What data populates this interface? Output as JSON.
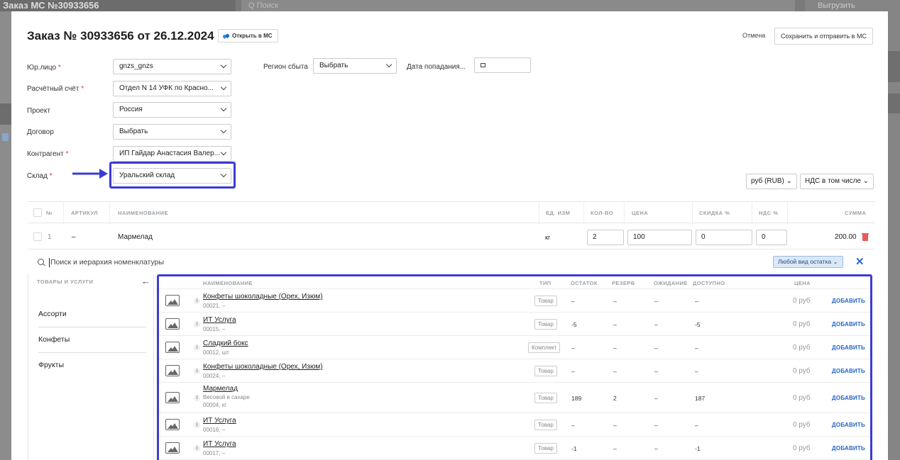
{
  "background": {
    "top_title": "Заказ МС №30933656",
    "search_placeholder": "Q Поиск",
    "action_button": "Выгрузить"
  },
  "header": {
    "title": "Заказ № 30933656 от 26.12.2024",
    "open_ms_label": "Открыть в МС",
    "cancel_label": "Отмена",
    "save_label": "Сохранить и отправить в МС"
  },
  "form": {
    "legal_entity": {
      "label": "Юр.лицо",
      "value": "gnzs_gnzs"
    },
    "account": {
      "label": "Расчётный счёт",
      "value": "Отдел N 14 УФК по Красно..."
    },
    "project": {
      "label": "Проект",
      "value": "Россия"
    },
    "contract": {
      "label": "Договор",
      "value": "Выбрать"
    },
    "counterparty": {
      "label": "Контрагент",
      "value": "ИП Гайдар Анастасия Валер..."
    },
    "warehouse": {
      "label": "Склад",
      "value": "Уральский склад"
    },
    "region": {
      "label": "Регион сбыта",
      "value": "Выбрать"
    },
    "date": {
      "label": "Дата попадания..."
    },
    "required_mark": "*",
    "currency": "руб (RUB)",
    "vat_mode": "НДС в том числе"
  },
  "order_table": {
    "columns": [
      "№",
      "АРТИКУЛ",
      "НАИМЕНОВАНИЕ",
      "ЕД. ИЗМ",
      "КОЛ-ВО",
      "ЦЕНА",
      "СКИДКА %",
      "НДС %",
      "СУММА"
    ],
    "rows": [
      {
        "num": "1",
        "article": "–",
        "name": "Мармелад",
        "unit": "кг",
        "qty": "2",
        "price": "100",
        "discount": "0",
        "vat": "0",
        "sum": "200.00"
      }
    ]
  },
  "search": {
    "placeholder": "Поиск и иерархия номенклатуры",
    "stock_filter": "Любой вид остатка",
    "close": "✕"
  },
  "categories": {
    "header": "ТОВАРЫ И УСЛУГИ",
    "back": "←",
    "items": [
      "Ассорти",
      "Конфеты",
      "Фрукты"
    ]
  },
  "products": {
    "columns": {
      "name": "НАИМЕНОВАНИЕ",
      "type": "ТИП",
      "stock": "ОСТАТОК",
      "reserve": "РЕЗЕРВ",
      "waiting": "ОЖИДАНИЕ",
      "available": "ДОСТУПНО",
      "price": "ЦЕНА"
    },
    "add_label": "ДОБАВИТЬ",
    "info": "i",
    "rows": [
      {
        "name": "Конфеты шоколадные (Орех, Изюм)",
        "desc": "",
        "code": "00021, –",
        "type": "Товар",
        "stock": "–",
        "reserve": "–",
        "waiting": "–",
        "available": "–",
        "price": "0 руб"
      },
      {
        "name": "ИТ Услуга",
        "desc": "",
        "code": "00015, –",
        "type": "Товар",
        "stock": "-5",
        "reserve": "–",
        "waiting": "–",
        "available": "-5",
        "price": "0 руб"
      },
      {
        "name": "Сладкий бокс",
        "desc": "",
        "code": "00012, шт",
        "type": "Комплект",
        "stock": "–",
        "reserve": "–",
        "waiting": "–",
        "available": "–",
        "price": "0 руб"
      },
      {
        "name": "Конфеты шоколадные (Орех, Изюм)",
        "desc": "",
        "code": "00024, –",
        "type": "Товар",
        "stock": "–",
        "reserve": "–",
        "waiting": "–",
        "available": "–",
        "price": "0 руб"
      },
      {
        "name": "Мармелад",
        "desc": "Весовой в сахаре",
        "code": "00004, кг",
        "type": "Товар",
        "stock": "189",
        "reserve": "2",
        "waiting": "–",
        "available": "187",
        "price": "0 руб"
      },
      {
        "name": "ИТ Услуга",
        "desc": "",
        "code": "00016, –",
        "type": "Товар",
        "stock": "–",
        "reserve": "–",
        "waiting": "–",
        "available": "–",
        "price": "0 руб"
      },
      {
        "name": "ИТ Услуга",
        "desc": "",
        "code": "00017, –",
        "type": "Товар",
        "stock": "-1",
        "reserve": "–",
        "waiting": "–",
        "available": "-1",
        "price": "0 руб"
      }
    ]
  },
  "colors": {
    "highlight": "#3b3bd6",
    "link": "#2466c8",
    "required": "#d9343b"
  }
}
